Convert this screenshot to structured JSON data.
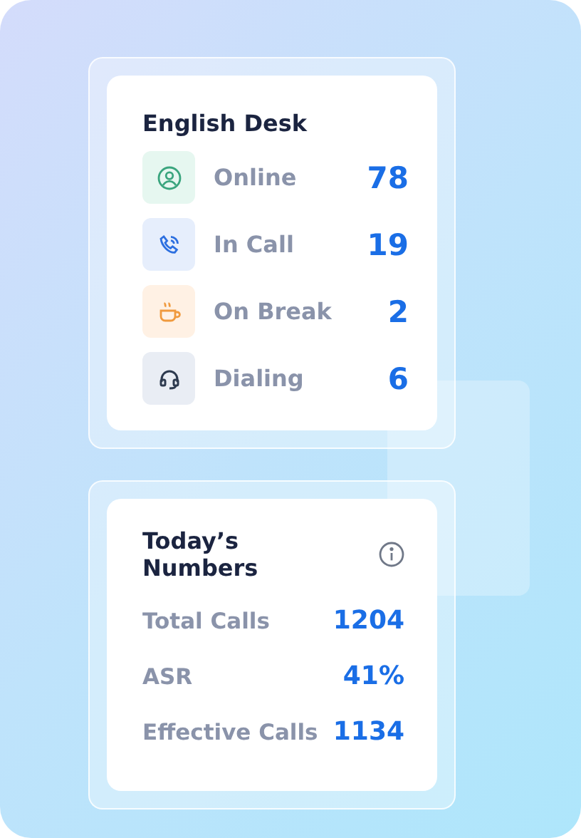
{
  "desk": {
    "title": "English Desk",
    "statuses": [
      {
        "kind": "online",
        "label": "Online",
        "value": "78"
      },
      {
        "kind": "call",
        "label": "In Call",
        "value": "19"
      },
      {
        "kind": "break",
        "label": "On Break",
        "value": "2"
      },
      {
        "kind": "dialing",
        "label": "Dialing",
        "value": "6"
      }
    ]
  },
  "numbers": {
    "title": "Today’s Numbers",
    "rows": [
      {
        "label": "Total Calls",
        "value": "1204"
      },
      {
        "label": "ASR",
        "value": "41%"
      },
      {
        "label": "Effective Calls",
        "value": "1134"
      }
    ]
  }
}
